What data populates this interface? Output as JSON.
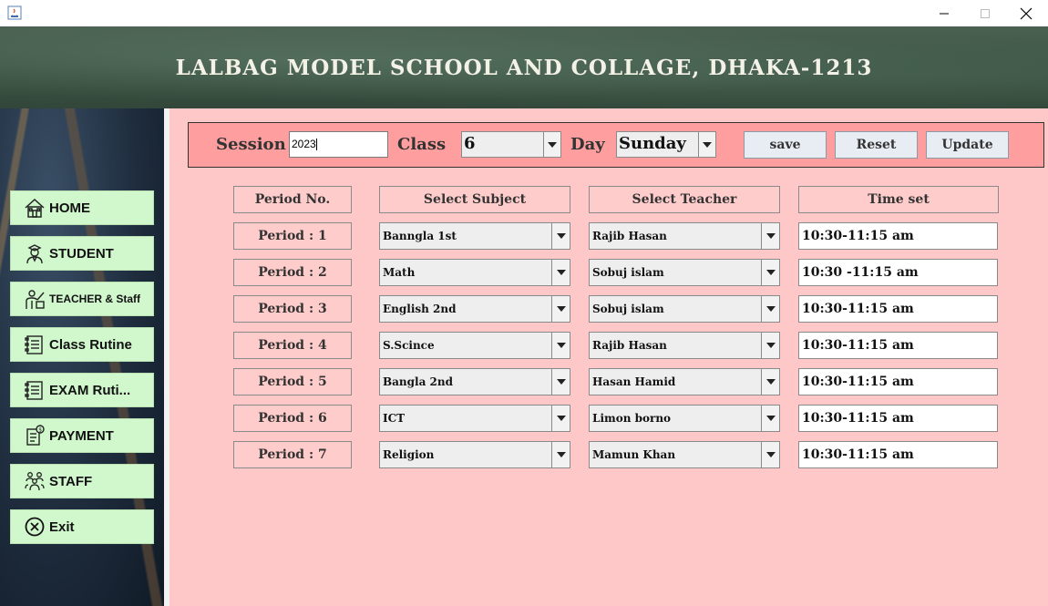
{
  "window": {
    "minimize_symbol": "—",
    "close_symbol": "✕"
  },
  "header": {
    "title": "LALBAG MODEL SCHOOL AND COLLAGE, DHAKA-1213"
  },
  "sidebar": {
    "items": [
      {
        "label": "HOME",
        "icon": "home-icon"
      },
      {
        "label": "STUDENT",
        "icon": "student-icon"
      },
      {
        "label": "TEACHER & Staff",
        "icon": "teacher-icon"
      },
      {
        "label": "Class Rutine",
        "icon": "routine-icon"
      },
      {
        "label": "EXAM Ruti...",
        "icon": "exam-routine-icon"
      },
      {
        "label": "PAYMENT",
        "icon": "payment-icon"
      },
      {
        "label": "STAFF",
        "icon": "staff-icon"
      },
      {
        "label": "Exit",
        "icon": "exit-icon"
      }
    ]
  },
  "filters": {
    "session_label": "Session",
    "session_value": "2023",
    "class_label": "Class",
    "class_value": "6",
    "day_label": "Day",
    "day_value": "Sunday",
    "save_label": "save",
    "reset_label": "Reset",
    "update_label": "Update"
  },
  "table": {
    "headers": {
      "period": "Period No.",
      "subject": "Select Subject",
      "teacher": "Select Teacher",
      "time": "Time set"
    },
    "rows": [
      {
        "period": "Period : 1",
        "subject": "Banngla 1st",
        "teacher": "Rajib Hasan",
        "time": "10:30-11:15 am"
      },
      {
        "period": "Period : 2",
        "subject": "Math",
        "teacher": "Sobuj islam",
        "time": "10:30 -11:15 am"
      },
      {
        "period": "Period : 3",
        "subject": "English 2nd",
        "teacher": "Sobuj islam",
        "time": "10:30-11:15 am"
      },
      {
        "period": "Period : 4",
        "subject": "S.Scince",
        "teacher": "Rajib Hasan",
        "time": "10:30-11:15 am"
      },
      {
        "period": "Period : 5",
        "subject": "Bangla 2nd",
        "teacher": "Hasan Hamid",
        "time": "10:30-11:15 am"
      },
      {
        "period": "Period : 6",
        "subject": "ICT",
        "teacher": "Limon borno",
        "time": "10:30-11:15 am"
      },
      {
        "period": "Period : 7",
        "subject": "Religion",
        "teacher": "Mamun Khan",
        "time": "10:30-11:15 am"
      }
    ]
  },
  "colors": {
    "header_bg": "#3d5546",
    "main_bg": "#ffc8c8",
    "panel_bg": "#ff9e9e",
    "nav_button_bg": "#d1f7cd"
  }
}
